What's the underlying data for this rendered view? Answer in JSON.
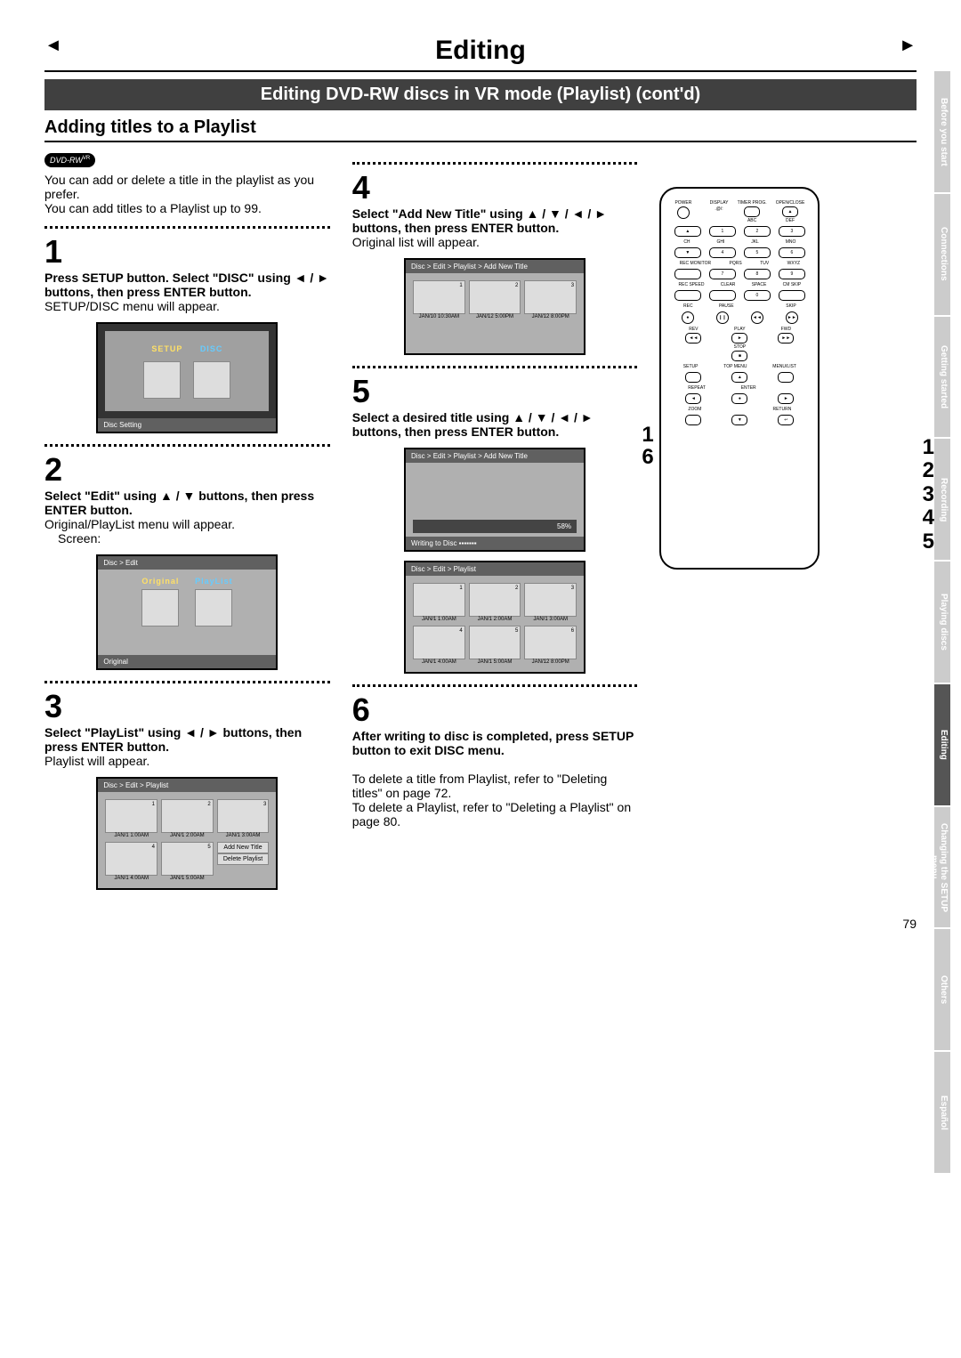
{
  "page_title": "Editing",
  "section_banner": "Editing DVD-RW discs in VR mode (Playlist) (cont'd)",
  "subsection": "Adding titles to a Playlist",
  "dvdrw_logo": "DVD-RW",
  "intro1": "You can add or delete a title in the playlist as you prefer.",
  "intro2": "You can add titles to a Playlist up to 99.",
  "steps": {
    "1": {
      "num": "1",
      "bold": "Press SETUP button. Select \"DISC\" using ◄ / ► buttons, then press ENTER button.",
      "text": "SETUP/DISC menu will appear."
    },
    "2": {
      "num": "2",
      "bold": "Select \"Edit\" using ▲ / ▼ buttons, then press ENTER button.",
      "text": "Original/PlayList menu will appear.",
      "text2": "Screen:"
    },
    "3": {
      "num": "3",
      "bold": "Select \"PlayList\" using ◄ / ► buttons, then press ENTER button.",
      "text": "Playlist will appear."
    },
    "4": {
      "num": "4",
      "bold": "Select \"Add New Title\" using ▲ / ▼ / ◄ / ► buttons, then press ENTER button.",
      "text": "Original list will appear."
    },
    "5": {
      "num": "5",
      "bold": "Select a desired title using ▲ / ▼ / ◄ / ► buttons, then press ENTER button."
    },
    "6": {
      "num": "6",
      "bold": "After writing to disc is completed, press SETUP button to exit DISC menu.",
      "text1": "To delete a title from Playlist, refer to \"Deleting titles\" on page 72.",
      "text2": "To delete a Playlist, refer to \"Deleting a Playlist\" on page 80."
    }
  },
  "screens": {
    "setup": {
      "tab1": "SETUP",
      "tab2": "DISC",
      "footer": "Disc Setting"
    },
    "edit": {
      "header": "Disc > Edit",
      "opt1": "Original",
      "opt2": "PlayList",
      "footer": "Original"
    },
    "playlist": {
      "header": "Disc > Edit > Playlist",
      "thumbs": [
        "1",
        "2",
        "3",
        "4",
        "5"
      ],
      "captions": [
        "JAN/1 1:00AM",
        "JAN/1 2:00AM",
        "JAN/1 3:00AM",
        "JAN/1 4:00AM",
        "JAN/1 5:00AM"
      ],
      "menu": [
        "Add New Title",
        "Delete Playlist"
      ]
    },
    "addnew": {
      "header": "Disc > Edit > Playlist > Add New Title",
      "thumbs": [
        "1",
        "2",
        "3"
      ],
      "captions": [
        "JAN/10 10:30AM",
        "JAN/12 5:00PM",
        "JAN/12 8:00PM"
      ]
    },
    "writing": {
      "header": "Disc > Edit > Playlist > Add New Title",
      "percent": "58%",
      "footer": "Writing to Disc"
    },
    "playlist2": {
      "header": "Disc > Edit > Playlist",
      "thumbs": [
        "1",
        "2",
        "3",
        "4",
        "5",
        "6"
      ],
      "captions": [
        "JAN/1 1:00AM",
        "JAN/1 2:00AM",
        "JAN/1 3:00AM",
        "JAN/1 4:00AM",
        "JAN/1 5:00AM",
        "JAN/12 8:00PM"
      ]
    }
  },
  "remote": {
    "callout_left_1": "1",
    "callout_left_6": "6",
    "callout_right": [
      "1",
      "2",
      "3",
      "4",
      "5"
    ],
    "labels": {
      "power": "POWER",
      "open": "OPEN/CLOSE",
      "timer": "TIMER PROG.",
      "display": "DISPLAY",
      "at": ".@/:",
      "abc": "ABC",
      "def": "DEF",
      "ch": "CH",
      "ghi": "GHI",
      "jkl": "JKL",
      "mno": "MNO",
      "rec_monitor": "REC MONITOR",
      "pqrs": "PQRS",
      "tuv": "TUV",
      "wxyz": "WXYZ",
      "rec_speed": "REC SPEED",
      "clear": "CLEAR",
      "space": "SPACE",
      "cm_skip": "CM SKIP",
      "rec": "REC",
      "pause": "PAUSE",
      "skip": "SKIP",
      "play": "PLAY",
      "rev": "REV",
      "fwd": "FWD",
      "stop": "STOP",
      "setup": "SETUP",
      "top_menu": "TOP MENU",
      "menu_list": "MENU/LIST",
      "repeat": "REPEAT",
      "enter": "ENTER",
      "zoom": "ZOOM",
      "return": "RETURN"
    }
  },
  "sidebar": [
    "Before you start",
    "Connections",
    "Getting started",
    "Recording",
    "Playing discs",
    "Editing",
    "Changing the SETUP menu",
    "Others",
    "Español"
  ],
  "sidebar_active": "Editing",
  "page_num": "79"
}
